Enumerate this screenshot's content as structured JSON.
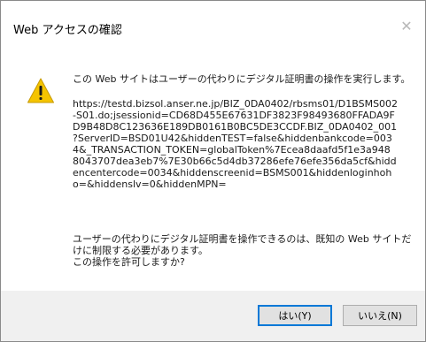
{
  "dialog": {
    "title": "Web アクセスの確認",
    "close_glyph": "✕",
    "icon": "warning-icon",
    "heading": "この Web サイトはユーザーの代わりにデジタル証明書の操作を実行します。",
    "url_lines": [
      "https://testd.bizsol.anser.ne.jp/BIZ_0DA0402/rbsms01/D1BSMS002",
      "-S01.do;jsessionid=CD68D455E67631DF3823F98493680FFADA9F",
      "D9B48D8C123636E189DB0161B0BC5DE3CCDF.BIZ_0DA0402_001",
      "?ServerID=BSD01U42&hiddenTEST=false&hiddenbankcode=003",
      "4&_TRANSACTION_TOKEN=globalToken%7Ecea8daafd5f1e3a948",
      "8043707dea3eb7%7E30b66c5d4db37286efe76efe356da5cf&hidd",
      "encentercode=0034&hiddenscreenid=BSMS001&hiddenloginhoh",
      "o=&hiddenslv=0&hiddenMPN="
    ],
    "question_lines": [
      "ユーザーの代わりにデジタル証明書を操作できるのは、既知の Web サイトだ",
      "けに制限する必要があります。",
      "この操作を許可しますか?"
    ],
    "yes_label": "はい(Y)",
    "no_label": "いいえ(N)",
    "colors": {
      "footer_bg": "#f0f0f0",
      "default_button_border": "#0078d7",
      "warning_yellow": "#f5c400"
    }
  }
}
